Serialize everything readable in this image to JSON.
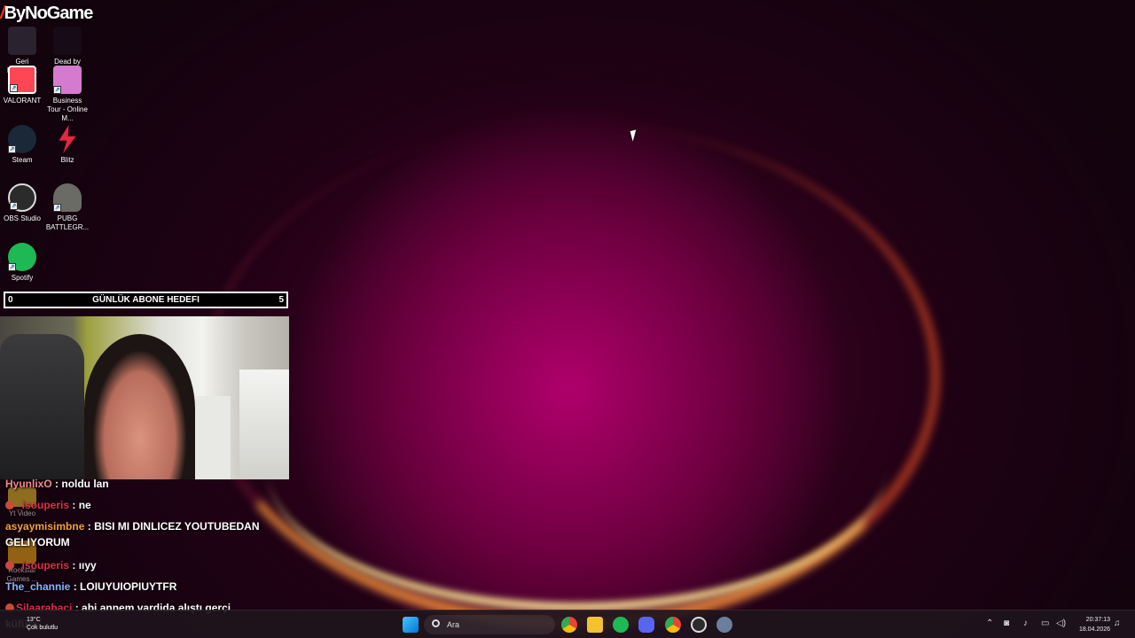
{
  "overlay": {
    "channel_logo": "ByNoGame",
    "goal": {
      "title": "GÜNLÜK ABONE HEDEFI",
      "current": "0",
      "target": "5"
    }
  },
  "desktop": {
    "icons": [
      {
        "label": "Geri Dönüşü...",
        "icon": "recycle-bin-icon",
        "color": "#8aa0b8"
      },
      {
        "label": "Dead by Daylight",
        "icon": "dead-by-daylight-icon",
        "color": "#2a2f3a"
      },
      {
        "label": "VALORANT",
        "icon": "valorant-icon",
        "color": "#ff4655"
      },
      {
        "label": "Business Tour - Online M...",
        "icon": "business-tour-icon",
        "color": "#d47bd0"
      },
      {
        "label": "Steam",
        "icon": "steam-icon",
        "color": "#1b2838"
      },
      {
        "label": "Blitz",
        "icon": "blitz-icon",
        "color": "#e52740"
      },
      {
        "label": "OBS Studio",
        "icon": "obs-icon",
        "color": "#2b2b2b"
      },
      {
        "label": "PUBG BATTLEGR...",
        "icon": "pubg-icon",
        "color": "#6b6b66"
      },
      {
        "label": "Spotify",
        "icon": "spotify-icon",
        "color": "#1db954"
      }
    ],
    "hidden_icons": [
      {
        "label": "Yt Video"
      },
      {
        "label": "Rockstar Games ..."
      }
    ]
  },
  "chat": {
    "messages": [
      {
        "user": "HyunlixO",
        "text": "noldu lan",
        "color": "#f08a8a",
        "badge": false
      },
      {
        "user": "_isouperis",
        "text": "ne",
        "color": "#e0304a",
        "badge": true
      },
      {
        "user": "asyaymisimbne",
        "text": "BISI MI DINLICEZ YOUTUBEDAN GELIYORUM",
        "color": "#f0a040",
        "badge": false
      },
      {
        "user": "_isouperis",
        "text": "ııyy",
        "color": "#e0304a",
        "badge": true
      },
      {
        "user": "The_channie",
        "text": "LOIUYUIOPIUYTFR",
        "color": "#8ab4f8",
        "badge": false
      },
      {
        "user": "Silaarabaci",
        "text": "abi annem vardida alıştı gerçi küfüre",
        "color": "#e0304a",
        "badge": true
      }
    ]
  },
  "taskbar": {
    "weather": {
      "temp": "13°C",
      "condition": "Çok bulutlu"
    },
    "search_placeholder": "Ara",
    "apps": [
      "start-icon",
      "chrome-icon",
      "file-explorer-icon",
      "spotify-icon",
      "discord-icon",
      "chrome-icon",
      "obs-icon",
      "settings-icon"
    ],
    "clock": {
      "time": "20:37:13",
      "date": "18.04.2026"
    }
  },
  "colors": {
    "accent": "#b3006e",
    "taskbar": "#1e141c"
  }
}
